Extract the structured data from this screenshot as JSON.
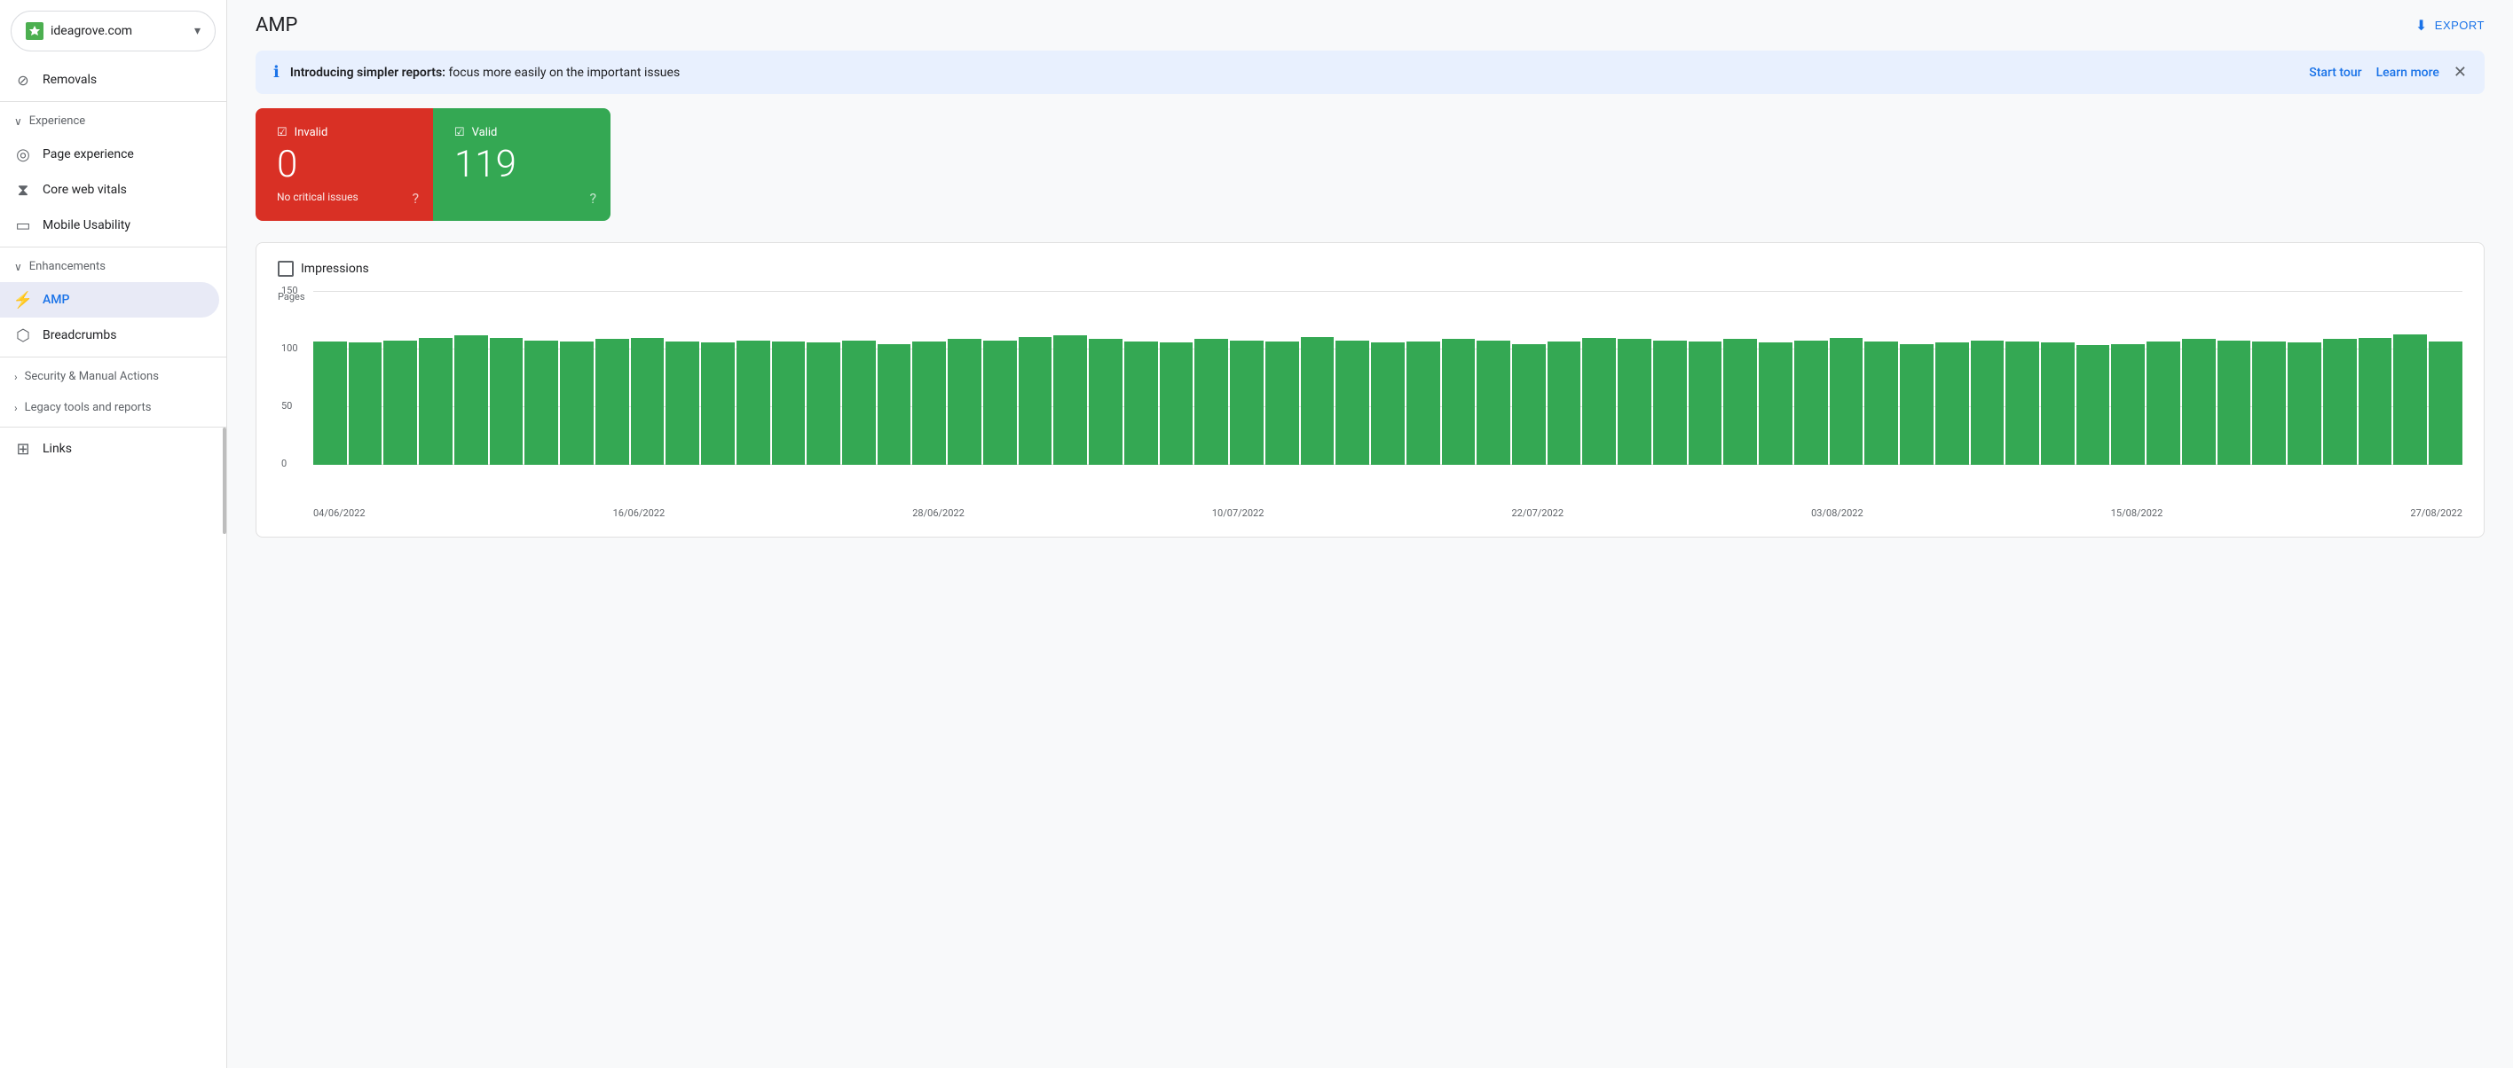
{
  "site": {
    "name": "ideagrove.com",
    "icon_color": "#4caf50"
  },
  "sidebar": {
    "removals_label": "Removals",
    "experience_section": "Experience",
    "experience_items": [
      {
        "label": "Page experience",
        "icon": "page-experience-icon"
      },
      {
        "label": "Core web vitals",
        "icon": "core-web-vitals-icon"
      },
      {
        "label": "Mobile Usability",
        "icon": "mobile-usability-icon"
      }
    ],
    "enhancements_section": "Enhancements",
    "enhancements_items": [
      {
        "label": "AMP",
        "icon": "amp-icon",
        "active": true
      },
      {
        "label": "Breadcrumbs",
        "icon": "breadcrumbs-icon"
      }
    ],
    "security_section": "Security & Manual Actions",
    "legacy_section": "Legacy tools and reports",
    "links_label": "Links"
  },
  "header": {
    "title": "AMP",
    "export_label": "EXPORT"
  },
  "banner": {
    "intro": "Introducing simpler reports:",
    "text": " focus more easily on the important issues",
    "start_tour": "Start tour",
    "learn_more": "Learn more"
  },
  "status": {
    "invalid": {
      "label": "Invalid",
      "count": "0",
      "subtitle": "No critical issues"
    },
    "valid": {
      "label": "Valid",
      "count": "119",
      "subtitle": ""
    }
  },
  "chart": {
    "impressions_label": "Impressions",
    "y_axis_label": "Pages",
    "y_max": "150",
    "y_mid": "100",
    "y_low": "50",
    "y_zero": "0",
    "x_labels": [
      "04/06/2022",
      "16/06/2022",
      "28/06/2022",
      "10/07/2022",
      "22/07/2022",
      "03/08/2022",
      "15/08/2022",
      "27/08/2022"
    ],
    "bars": [
      107,
      106,
      108,
      110,
      112,
      110,
      108,
      107,
      109,
      110,
      107,
      106,
      108,
      107,
      106,
      108,
      105,
      107,
      109,
      108,
      111,
      112,
      109,
      107,
      106,
      109,
      108,
      107,
      111,
      108,
      106,
      107,
      109,
      108,
      105,
      107,
      110,
      109,
      108,
      107,
      109,
      106,
      108,
      110,
      107,
      105,
      106,
      108,
      107,
      106,
      104,
      105,
      107,
      109,
      108,
      107,
      106,
      109,
      110,
      113,
      107
    ]
  }
}
